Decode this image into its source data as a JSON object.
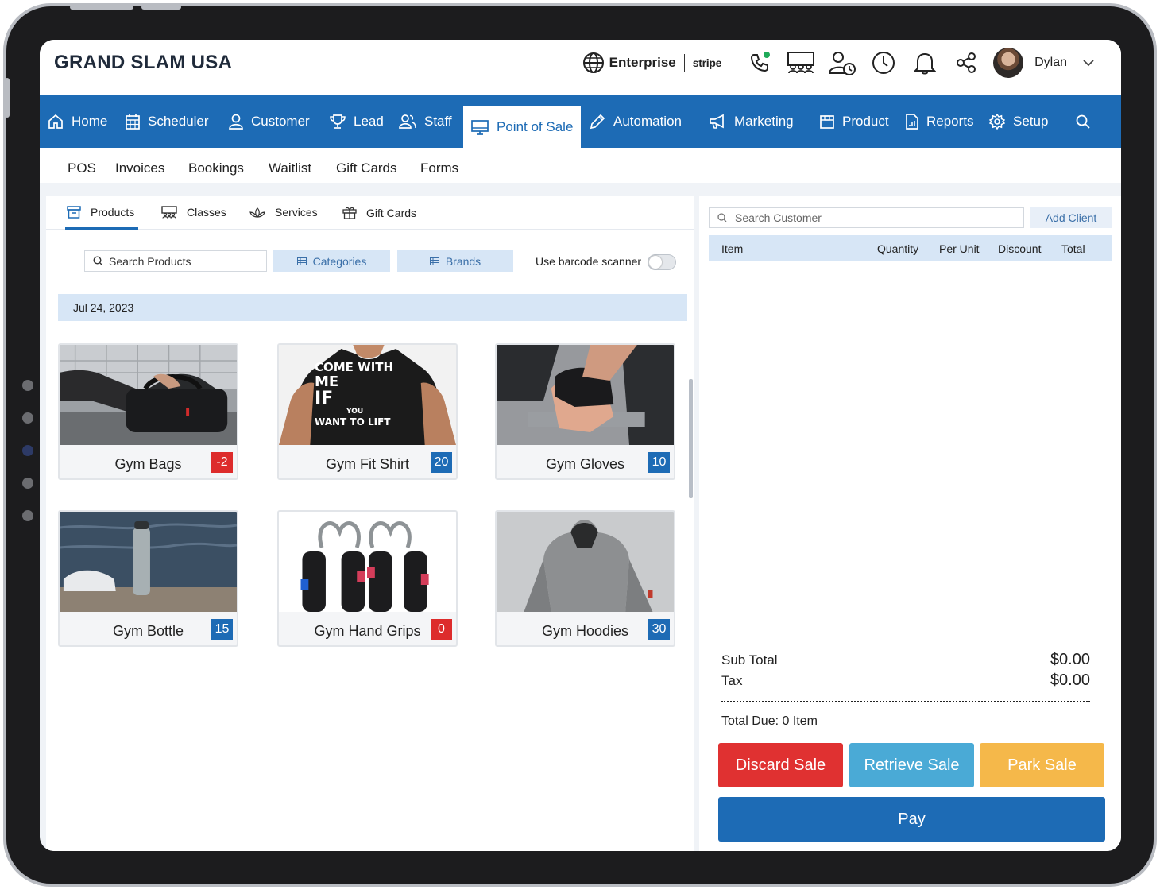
{
  "header": {
    "brand": "GRAND SLAM USA",
    "plan": "Enterprise",
    "payment": "stripe",
    "user_name": "Dylan"
  },
  "nav": {
    "items": [
      {
        "label": "Home",
        "icon": "home-icon"
      },
      {
        "label": "Scheduler",
        "icon": "calendar-icon"
      },
      {
        "label": "Customer",
        "icon": "user-icon"
      },
      {
        "label": "Lead",
        "icon": "trophy-icon"
      },
      {
        "label": "Staff",
        "icon": "users-icon"
      },
      {
        "label": "Point of Sale",
        "icon": "monitor-icon",
        "active": true
      },
      {
        "label": "Automation",
        "icon": "pencil-icon"
      },
      {
        "label": "Marketing",
        "icon": "megaphone-icon"
      },
      {
        "label": "Product",
        "icon": "box-icon"
      },
      {
        "label": "Reports",
        "icon": "document-icon"
      },
      {
        "label": "Setup",
        "icon": "gear-icon"
      }
    ]
  },
  "subnav": [
    "POS",
    "Invoices",
    "Bookings",
    "Waitlist",
    "Gift Cards",
    "Forms"
  ],
  "catalog": {
    "tabs": [
      "Products",
      "Classes",
      "Services",
      "Gift Cards"
    ],
    "search_placeholder": "Search Products",
    "categories_label": "Categories",
    "brands_label": "Brands",
    "barcode_label": "Use barcode scanner",
    "barcode_enabled": false,
    "date": "Jul 24, 2023",
    "products": [
      {
        "name": "Gym Bags",
        "stock": "-2",
        "status": "negative"
      },
      {
        "name": "Gym Fit Shirt",
        "stock": "20",
        "status": "ok"
      },
      {
        "name": "Gym Gloves",
        "stock": "10",
        "status": "ok"
      },
      {
        "name": "Gym Bottle",
        "stock": "15",
        "status": "ok"
      },
      {
        "name": "Gym Hand Grips",
        "stock": "0",
        "status": "negative"
      },
      {
        "name": "Gym Hoodies",
        "stock": "30",
        "status": "ok"
      }
    ],
    "shirt_print": {
      "line1": "COME WITH",
      "line2": "ME",
      "line3": "IF",
      "line4": "YOU",
      "line5": "WANT TO LIFT"
    }
  },
  "cart": {
    "search_placeholder": "Search Customer",
    "add_client": "Add Client",
    "columns": [
      "Item",
      "Quantity",
      "Per Unit",
      "Discount",
      "Total"
    ],
    "sub_total_label": "Sub Total",
    "sub_total": "$0.00",
    "tax_label": "Tax",
    "tax": "$0.00",
    "total_due": "Total Due: 0 Item",
    "discard": "Discard Sale",
    "retrieve": "Retrieve Sale",
    "park": "Park Sale",
    "pay": "Pay"
  },
  "colors": {
    "primary": "#1d6bb5",
    "danger": "#e03131",
    "info": "#4aaad6",
    "warning": "#f5b84a",
    "light_blue": "#d7e6f6"
  }
}
